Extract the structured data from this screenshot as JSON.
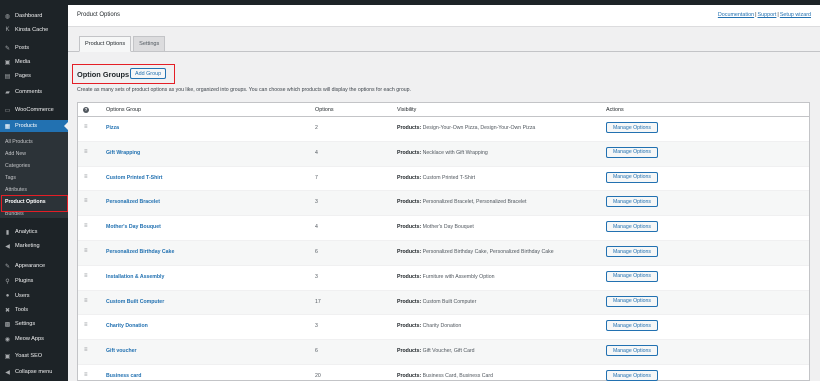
{
  "sidebar": {
    "items": [
      {
        "label": "Dashboard",
        "icon": "dashboard-icon",
        "glyph": "◍"
      },
      {
        "label": "Kinsta Cache",
        "icon": "kinsta-icon",
        "glyph": "K"
      },
      {
        "label": "Posts",
        "icon": "pin-icon",
        "glyph": "✎"
      },
      {
        "label": "Media",
        "icon": "media-icon",
        "glyph": "▣"
      },
      {
        "label": "Pages",
        "icon": "pages-icon",
        "glyph": "▤"
      },
      {
        "label": "Comments",
        "icon": "comments-icon",
        "glyph": "▰"
      },
      {
        "label": "WooCommerce",
        "icon": "woo-icon",
        "glyph": "▭"
      },
      {
        "label": "Products",
        "icon": "products-icon",
        "glyph": "▦"
      },
      {
        "label": "Analytics",
        "icon": "analytics-icon",
        "glyph": "▮"
      },
      {
        "label": "Marketing",
        "icon": "marketing-icon",
        "glyph": "◀"
      },
      {
        "label": "Appearance",
        "icon": "appearance-icon",
        "glyph": "✎"
      },
      {
        "label": "Plugins",
        "icon": "plugins-icon",
        "glyph": "⚲"
      },
      {
        "label": "Users",
        "icon": "users-icon",
        "glyph": "●"
      },
      {
        "label": "Tools",
        "icon": "tools-icon",
        "glyph": "✖"
      },
      {
        "label": "Settings",
        "icon": "settings-icon",
        "glyph": "▩"
      },
      {
        "label": "Meow Apps",
        "icon": "meow-icon",
        "glyph": "◉"
      },
      {
        "label": "Yoast SEO",
        "icon": "yoast-icon",
        "glyph": "▣"
      },
      {
        "label": "Collapse menu",
        "icon": "collapse-icon",
        "glyph": "◀"
      }
    ],
    "submenu": [
      "All Products",
      "Add New",
      "Categories",
      "Tags",
      "Attributes",
      "Product Options",
      "Bundles"
    ]
  },
  "header": {
    "title": "Product Options",
    "links": [
      "Documentation",
      "Support",
      "Setup wizard"
    ],
    "separator": "|"
  },
  "tabs": [
    "Product Options",
    "Settings"
  ],
  "section": {
    "title": "Option Groups",
    "add_button": "Add Group",
    "intro": "Create as many sets of product options as you like, organized into groups. You can choose which products will display the options for each group."
  },
  "table": {
    "help_glyph": "?",
    "headers": [
      "Options Group",
      "Options",
      "Visibility",
      "Actions"
    ],
    "visibility_prefix": "Products:",
    "action_label": "Manage Options",
    "drag_glyph": "≡",
    "rows": [
      {
        "name": "Pizza",
        "options": "2",
        "visibility": "Design-Your-Own Pizza, Design-Your-Own Pizza"
      },
      {
        "name": "Gift Wrapping",
        "options": "4",
        "visibility": "Necklace with Gift Wrapping"
      },
      {
        "name": "Custom Printed T-Shirt",
        "options": "7",
        "visibility": "Custom Printed T-Shirt"
      },
      {
        "name": "Personalized Bracelet",
        "options": "3",
        "visibility": "Personalized Bracelet, Personalized Bracelet"
      },
      {
        "name": "Mother's Day Bouquet",
        "options": "4",
        "visibility": "Mother's Day Bouquet"
      },
      {
        "name": "Personalized Birthday Cake",
        "options": "6",
        "visibility": "Personalized Birthday Cake, Personalized Birthday Cake"
      },
      {
        "name": "Installation & Assembly",
        "options": "3",
        "visibility": "Furniture with Assembly Option"
      },
      {
        "name": "Custom Built Computer",
        "options": "17",
        "visibility": "Custom Built Computer"
      },
      {
        "name": "Charity Donation",
        "options": "3",
        "visibility": "Charity Donation"
      },
      {
        "name": "Gift voucher",
        "options": "6",
        "visibility": "Gift Voucher, Gift Card"
      },
      {
        "name": "Business card",
        "options": "20",
        "visibility": "Business Card, Business Card"
      }
    ]
  },
  "colors": {
    "accent": "#2271b1",
    "sidebar": "#1d2327",
    "highlight_box": "#e41e26"
  }
}
